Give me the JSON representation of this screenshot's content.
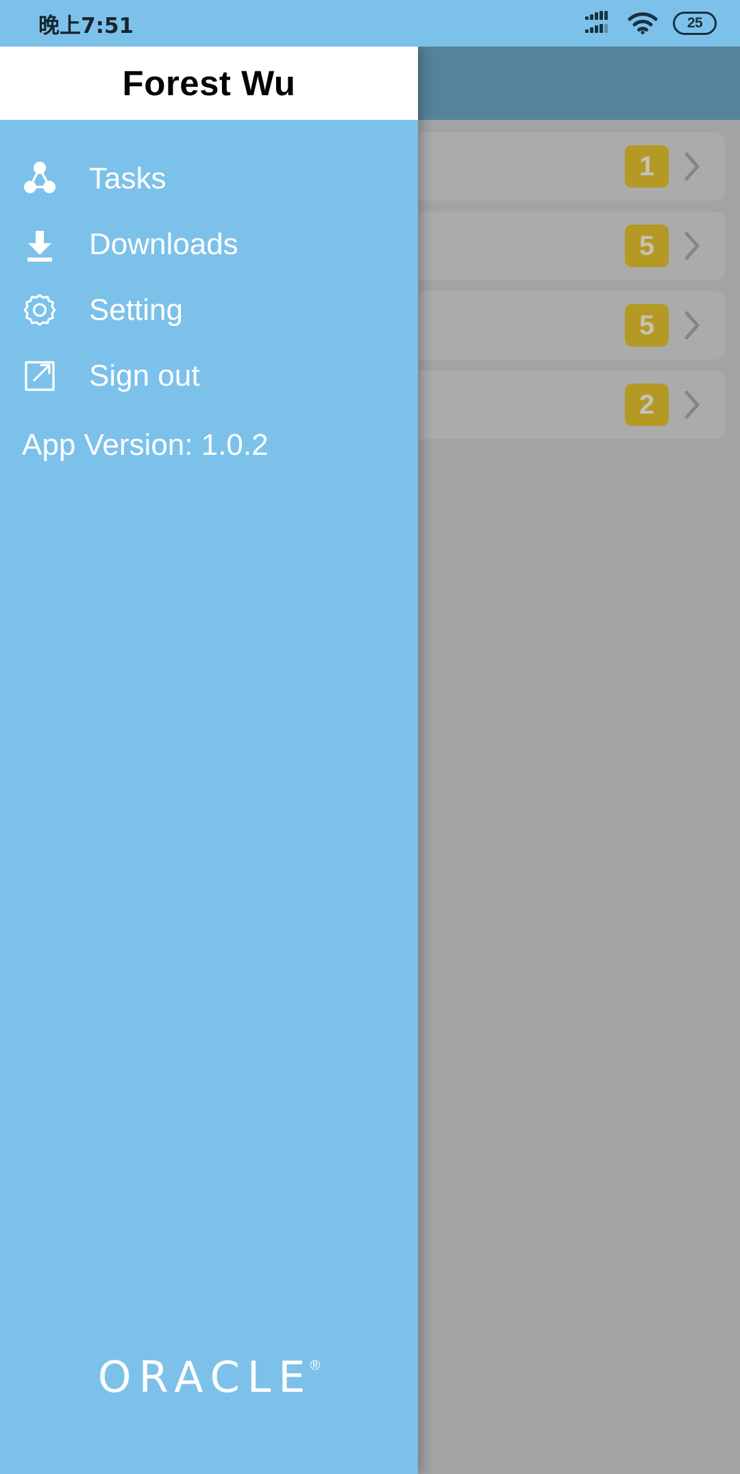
{
  "status_bar": {
    "time": "晚上7:51",
    "signal_icon": "cellular-signal-icon",
    "wifi_icon": "wifi-icon",
    "battery_level": "25"
  },
  "drawer": {
    "title": "Forest Wu",
    "items": [
      {
        "label": "Tasks",
        "icon": "share-nodes-icon"
      },
      {
        "label": "Downloads",
        "icon": "download-icon"
      },
      {
        "label": "Setting",
        "icon": "gear-icon"
      },
      {
        "label": "Sign out",
        "icon": "open-in-new-icon"
      }
    ],
    "app_version": "App Version: 1.0.2",
    "logo": {
      "wordmark": "ORACLE",
      "registered_mark": "®"
    }
  },
  "background": {
    "cards": [
      {
        "badge": "1",
        "chevron": "chevron-right-icon"
      },
      {
        "badge": "5",
        "chevron": "chevron-right-icon"
      },
      {
        "badge": "5",
        "chevron": "chevron-right-icon"
      },
      {
        "badge": "2",
        "chevron": "chevron-right-icon"
      }
    ]
  },
  "colors": {
    "drawer_blue": "#7CC1EA",
    "appbar_blue": "#4A87AB",
    "badge_gold": "#CFA800",
    "card_gray": "#C2C2C2"
  }
}
